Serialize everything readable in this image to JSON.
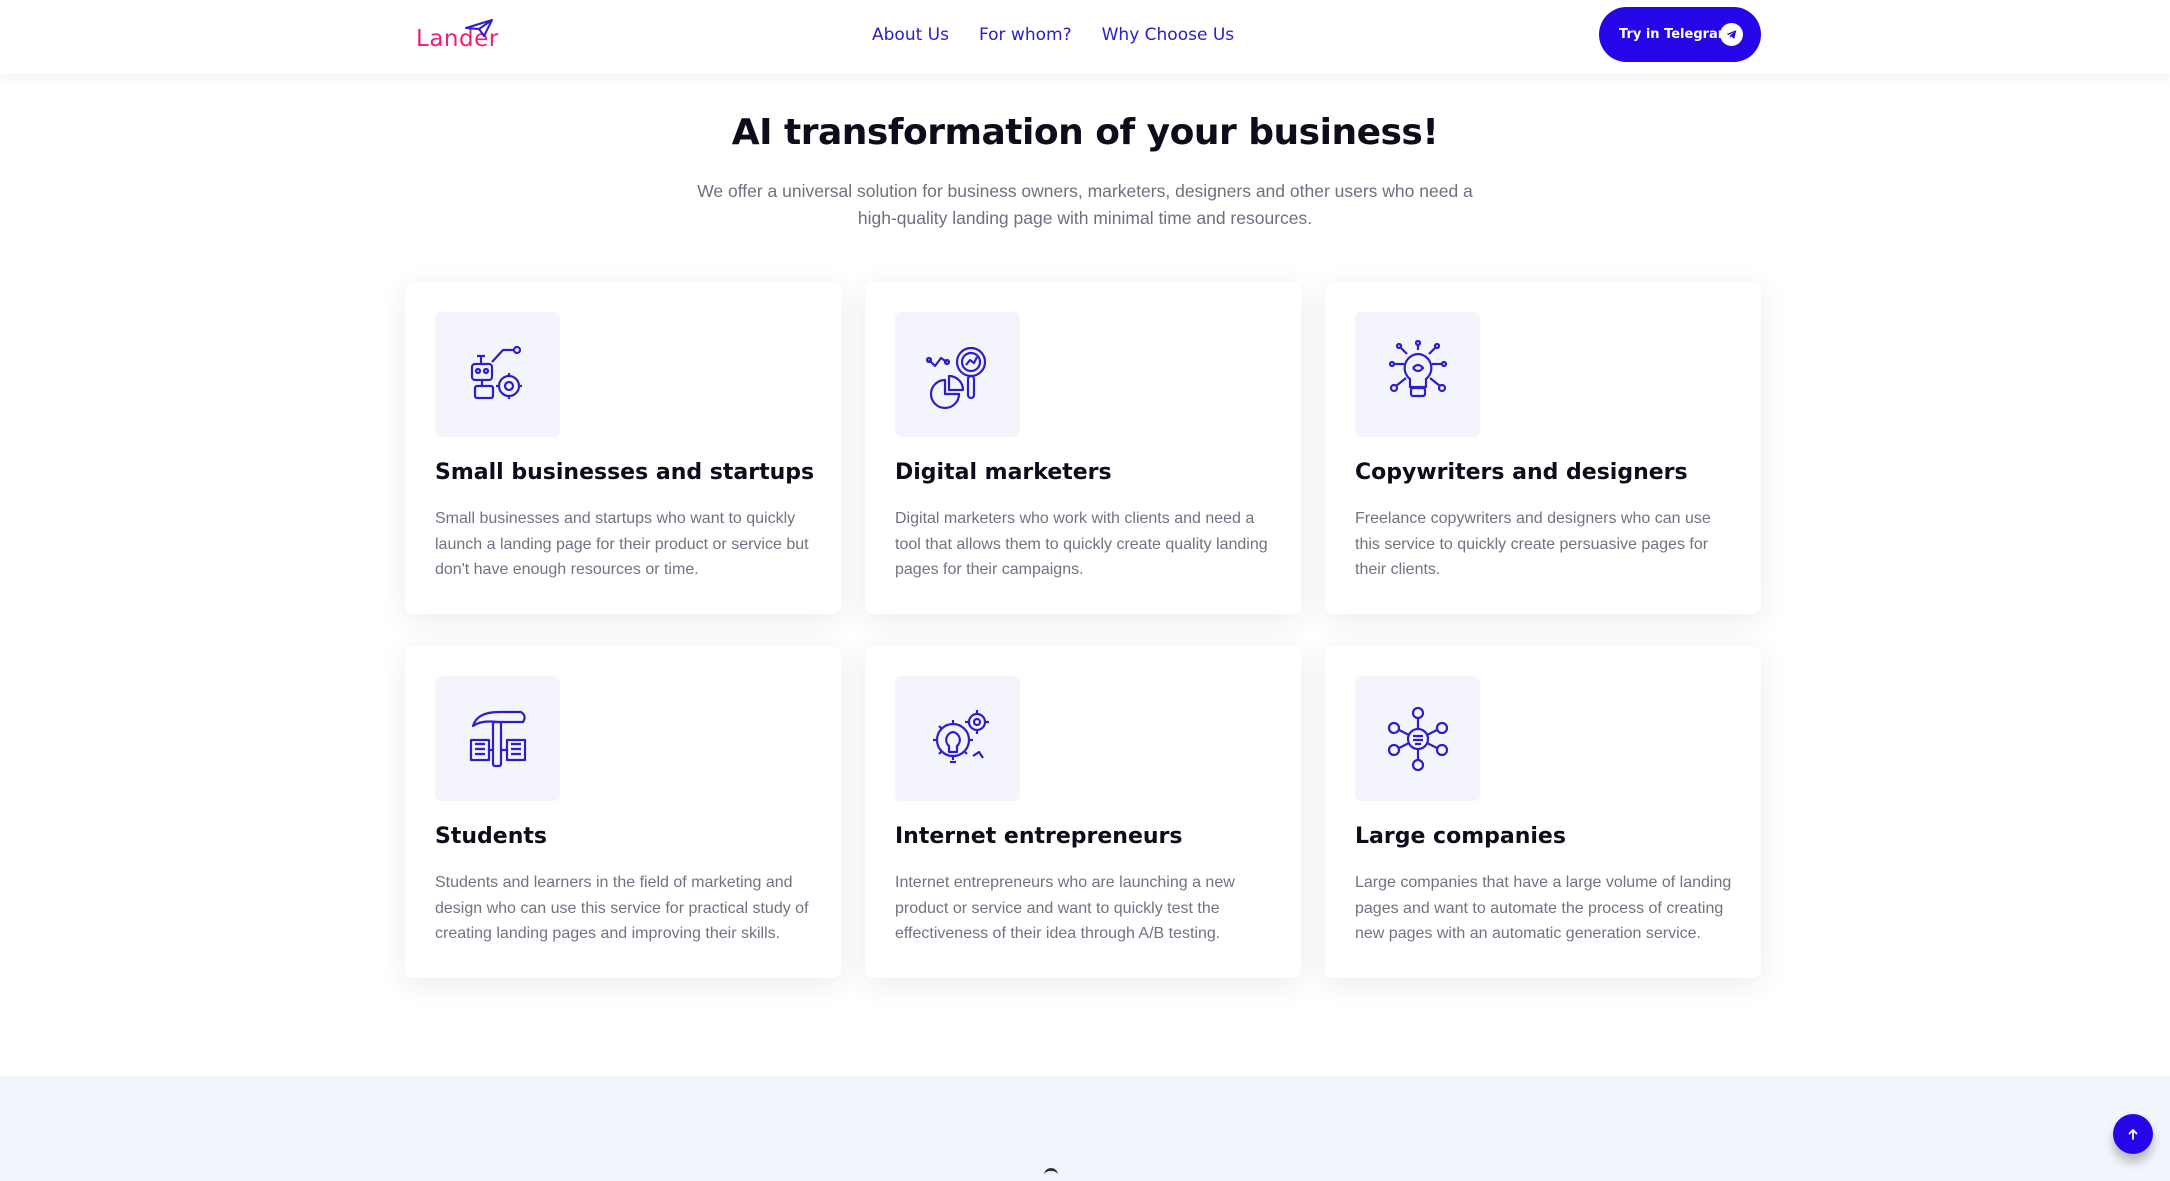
{
  "brand": {
    "logo_text": "Lander",
    "logo_color": "#ee1f78",
    "accent": "#2506e8"
  },
  "nav": {
    "items": [
      {
        "label": "About Us"
      },
      {
        "label": "For whom?"
      },
      {
        "label": "Why Choose Us"
      }
    ]
  },
  "cta": {
    "label": "Try in Telegram",
    "icon": "telegram-icon"
  },
  "hero": {
    "title": "AI transformation of your business!",
    "subtitle": "We offer a universal solution for business owners, marketers, designers and other users who need a high-quality landing page with minimal time and resources."
  },
  "cards": [
    {
      "icon": "robot-gear-icon",
      "title": "Small businesses and startups",
      "text": "Small businesses and startups who want to quickly launch a landing page for their product or service but don't have enough resources or time."
    },
    {
      "icon": "analytics-magnifier-icon",
      "title": "Digital marketers",
      "text": "Digital marketers who work with clients and need a tool that allows them to quickly create quality landing pages for their campaigns."
    },
    {
      "icon": "idea-bulb-icon",
      "title": "Copywriters and designers",
      "text": "Freelance copywriters and designers who can use this service to quickly create persuasive pages for their clients."
    },
    {
      "icon": "hammer-icon",
      "title": "Students",
      "text": "Students and learners in the field of marketing and design who can use this service for practical study of creating landing pages and improving their skills."
    },
    {
      "icon": "bulb-gears-icon",
      "title": "Internet entrepreneurs",
      "text": "Internet entrepreneurs who are launching a new product or service and want to quickly test the effectiveness of their idea through A/B testing."
    },
    {
      "icon": "network-hub-icon",
      "title": "Large companies",
      "text": "Large companies that have a large volume of landing pages and want to automate the process of creating new pages with an automatic generation service."
    }
  ],
  "scroll_top": {
    "icon": "arrow-up-icon"
  }
}
